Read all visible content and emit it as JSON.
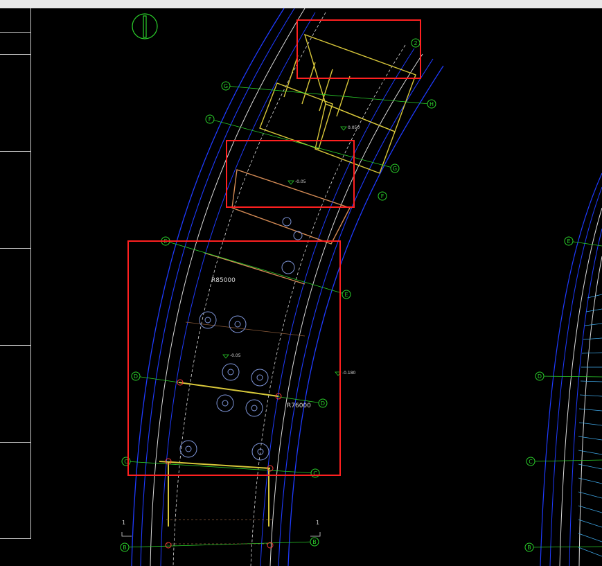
{
  "app": {
    "title": ""
  },
  "drawing": {
    "callouts": {
      "dimension_r85000": "R85000",
      "dimension_r76000": "R76000"
    },
    "axis_labels": {
      "h": "H",
      "g": "G",
      "f": "F",
      "e": "E",
      "d": "D",
      "c": "C",
      "b": "B",
      "two": "2",
      "one": "1"
    },
    "levels": {
      "upper": "0.050",
      "mid": "-0.05",
      "right": "-0.180",
      "lower": "-0.05"
    },
    "colors": {
      "background": "#000000",
      "outline_blue": "#1f3bff",
      "axis_green": "#2bd12b",
      "grid_white": "#dcdcdc",
      "wall_yellow": "#d8c73a",
      "furniture_blue": "#7e95d8",
      "annotation_red": "#ff2020",
      "orange_line": "#d48b55"
    }
  }
}
